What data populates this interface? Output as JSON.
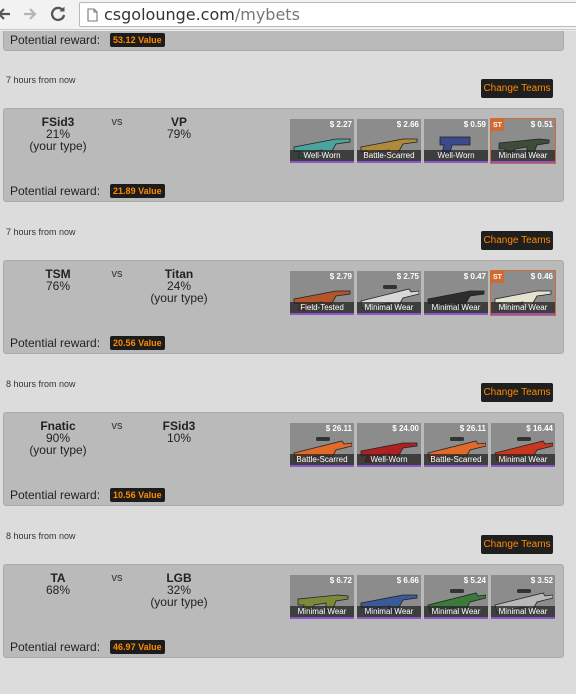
{
  "browser": {
    "url_domain": "csgolounge.com",
    "url_path": "/mybets"
  },
  "top_panel": {
    "reward_label": "Potential reward:",
    "reward_value": "53.12 Value"
  },
  "bets": [
    {
      "time": "7 hours from now",
      "change_label": "Change Teams",
      "team1": {
        "name": "FSid3",
        "pct": "21%",
        "note": "(your type)"
      },
      "vs": "vs",
      "team2": {
        "name": "VP",
        "pct": "79%",
        "note": ""
      },
      "reward_label": "Potential reward:",
      "reward_value": "21.89 Value",
      "items": [
        {
          "price": "$ 2.27",
          "wear": "Well-Worn",
          "st": "",
          "icon": "rifle-icon",
          "color": "#4aa39c"
        },
        {
          "price": "$ 2.66",
          "wear": "Battle-Scarred",
          "st": "",
          "icon": "rifle-icon",
          "color": "#b08a3c"
        },
        {
          "price": "$ 0.59",
          "wear": "Well-Worn",
          "st": "",
          "icon": "pistol-icon",
          "color": "#3b4a8a"
        },
        {
          "price": "$ 0.51",
          "wear": "Minimal Wear",
          "st": "ST",
          "icon": "smg-icon",
          "color": "#3f4b3b"
        }
      ]
    },
    {
      "time": "7 hours from now",
      "change_label": "Change Teams",
      "team1": {
        "name": "TSM",
        "pct": "76%",
        "note": ""
      },
      "vs": "vs",
      "team2": {
        "name": "Titan",
        "pct": "24%",
        "note": "(your type)"
      },
      "reward_label": "Potential reward:",
      "reward_value": "20.56 Value",
      "items": [
        {
          "price": "$ 2.79",
          "wear": "Field-Tested",
          "st": "",
          "icon": "rifle-icon",
          "color": "#b3542a"
        },
        {
          "price": "$ 2.75",
          "wear": "Minimal Wear",
          "st": "",
          "icon": "sniper-icon",
          "color": "#d8d8d8"
        },
        {
          "price": "$ 0.47",
          "wear": "Minimal Wear",
          "st": "",
          "icon": "rifle-icon",
          "color": "#2d2d2d"
        },
        {
          "price": "$ 0.46",
          "wear": "Minimal Wear",
          "st": "ST",
          "icon": "rifle-icon",
          "color": "#e3e3d0"
        }
      ]
    },
    {
      "time": "8 hours from now",
      "change_label": "Change Teams",
      "team1": {
        "name": "Fnatic",
        "pct": "90%",
        "note": "(your type)"
      },
      "vs": "vs",
      "team2": {
        "name": "FSid3",
        "pct": "10%",
        "note": ""
      },
      "reward_label": "Potential reward:",
      "reward_value": "10.56 Value",
      "items": [
        {
          "price": "$ 26.11",
          "wear": "Battle-Scarred",
          "st": "",
          "icon": "sniper-icon",
          "color": "#e06a2a"
        },
        {
          "price": "$ 24.00",
          "wear": "Well-Worn",
          "st": "",
          "icon": "rifle-icon",
          "color": "#b02020"
        },
        {
          "price": "$ 26.11",
          "wear": "Battle-Scarred",
          "st": "",
          "icon": "sniper-icon",
          "color": "#e06a2a"
        },
        {
          "price": "$ 16.44",
          "wear": "Minimal Wear",
          "st": "",
          "icon": "sniper-icon",
          "color": "#c8381e"
        }
      ]
    },
    {
      "time": "8 hours from now",
      "change_label": "Change Teams",
      "team1": {
        "name": "TA",
        "pct": "68%",
        "note": ""
      },
      "vs": "vs",
      "team2": {
        "name": "LGB",
        "pct": "32%",
        "note": "(your type)"
      },
      "reward_label": "Potential reward:",
      "reward_value": "46.97 Value",
      "items": [
        {
          "price": "$ 6.72",
          "wear": "Minimal Wear",
          "st": "",
          "icon": "smg-icon",
          "color": "#7a8a3a"
        },
        {
          "price": "$ 6.66",
          "wear": "Minimal Wear",
          "st": "",
          "icon": "rifle-icon",
          "color": "#3a5a9a"
        },
        {
          "price": "$ 5.24",
          "wear": "Minimal Wear",
          "st": "",
          "icon": "sniper-icon",
          "color": "#3a7a3a"
        },
        {
          "price": "$ 3.52",
          "wear": "Minimal Wear",
          "st": "",
          "icon": "sniper-icon",
          "color": "#b9b9b9"
        }
      ]
    }
  ],
  "colors": {
    "accent": "#ff8a00",
    "badge_bg": "#1c1c1c",
    "panel_bg": "#bababa",
    "page_bg": "#dcdcdc",
    "st_badge": "#cf6a32"
  }
}
